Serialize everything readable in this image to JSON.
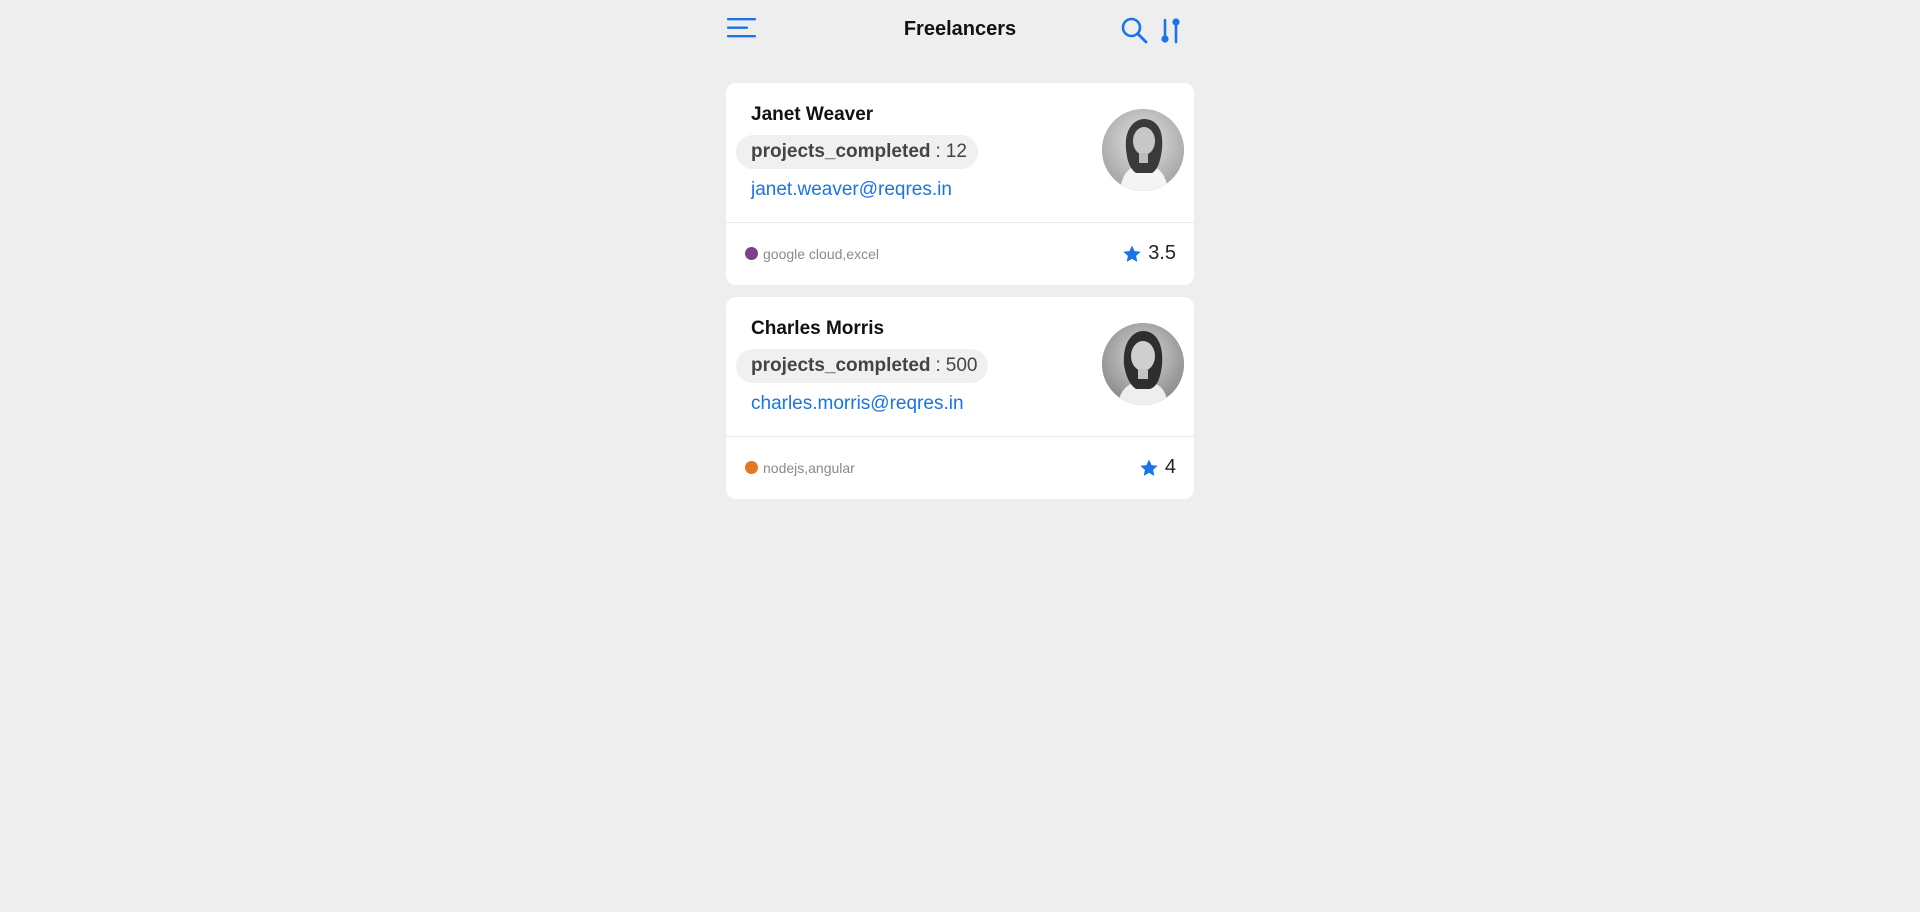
{
  "header": {
    "title": "Freelancers",
    "menu_icon": "menu-icon",
    "search_icon": "search-icon",
    "sort_icon": "sort-icon"
  },
  "colors": {
    "accent": "#1a73e8",
    "background": "#eeeeee",
    "card": "#ffffff"
  },
  "freelancers": [
    {
      "name": "Janet Weaver",
      "projects_key": "projects_completed",
      "projects_sep": ":",
      "projects_value": "12",
      "email": "janet.weaver@reqres.in",
      "skills": "google cloud,excel",
      "skill_color": "#7b3f8c",
      "rating": "3.5",
      "rating_icon": "star-icon"
    },
    {
      "name": "Charles Morris",
      "projects_key": "projects_completed",
      "projects_sep": ":",
      "projects_value": "500",
      "email": "charles.morris@reqres.in",
      "skills": "nodejs,angular",
      "skill_color": "#e8761c",
      "rating": "4",
      "rating_icon": "star-icon"
    }
  ]
}
